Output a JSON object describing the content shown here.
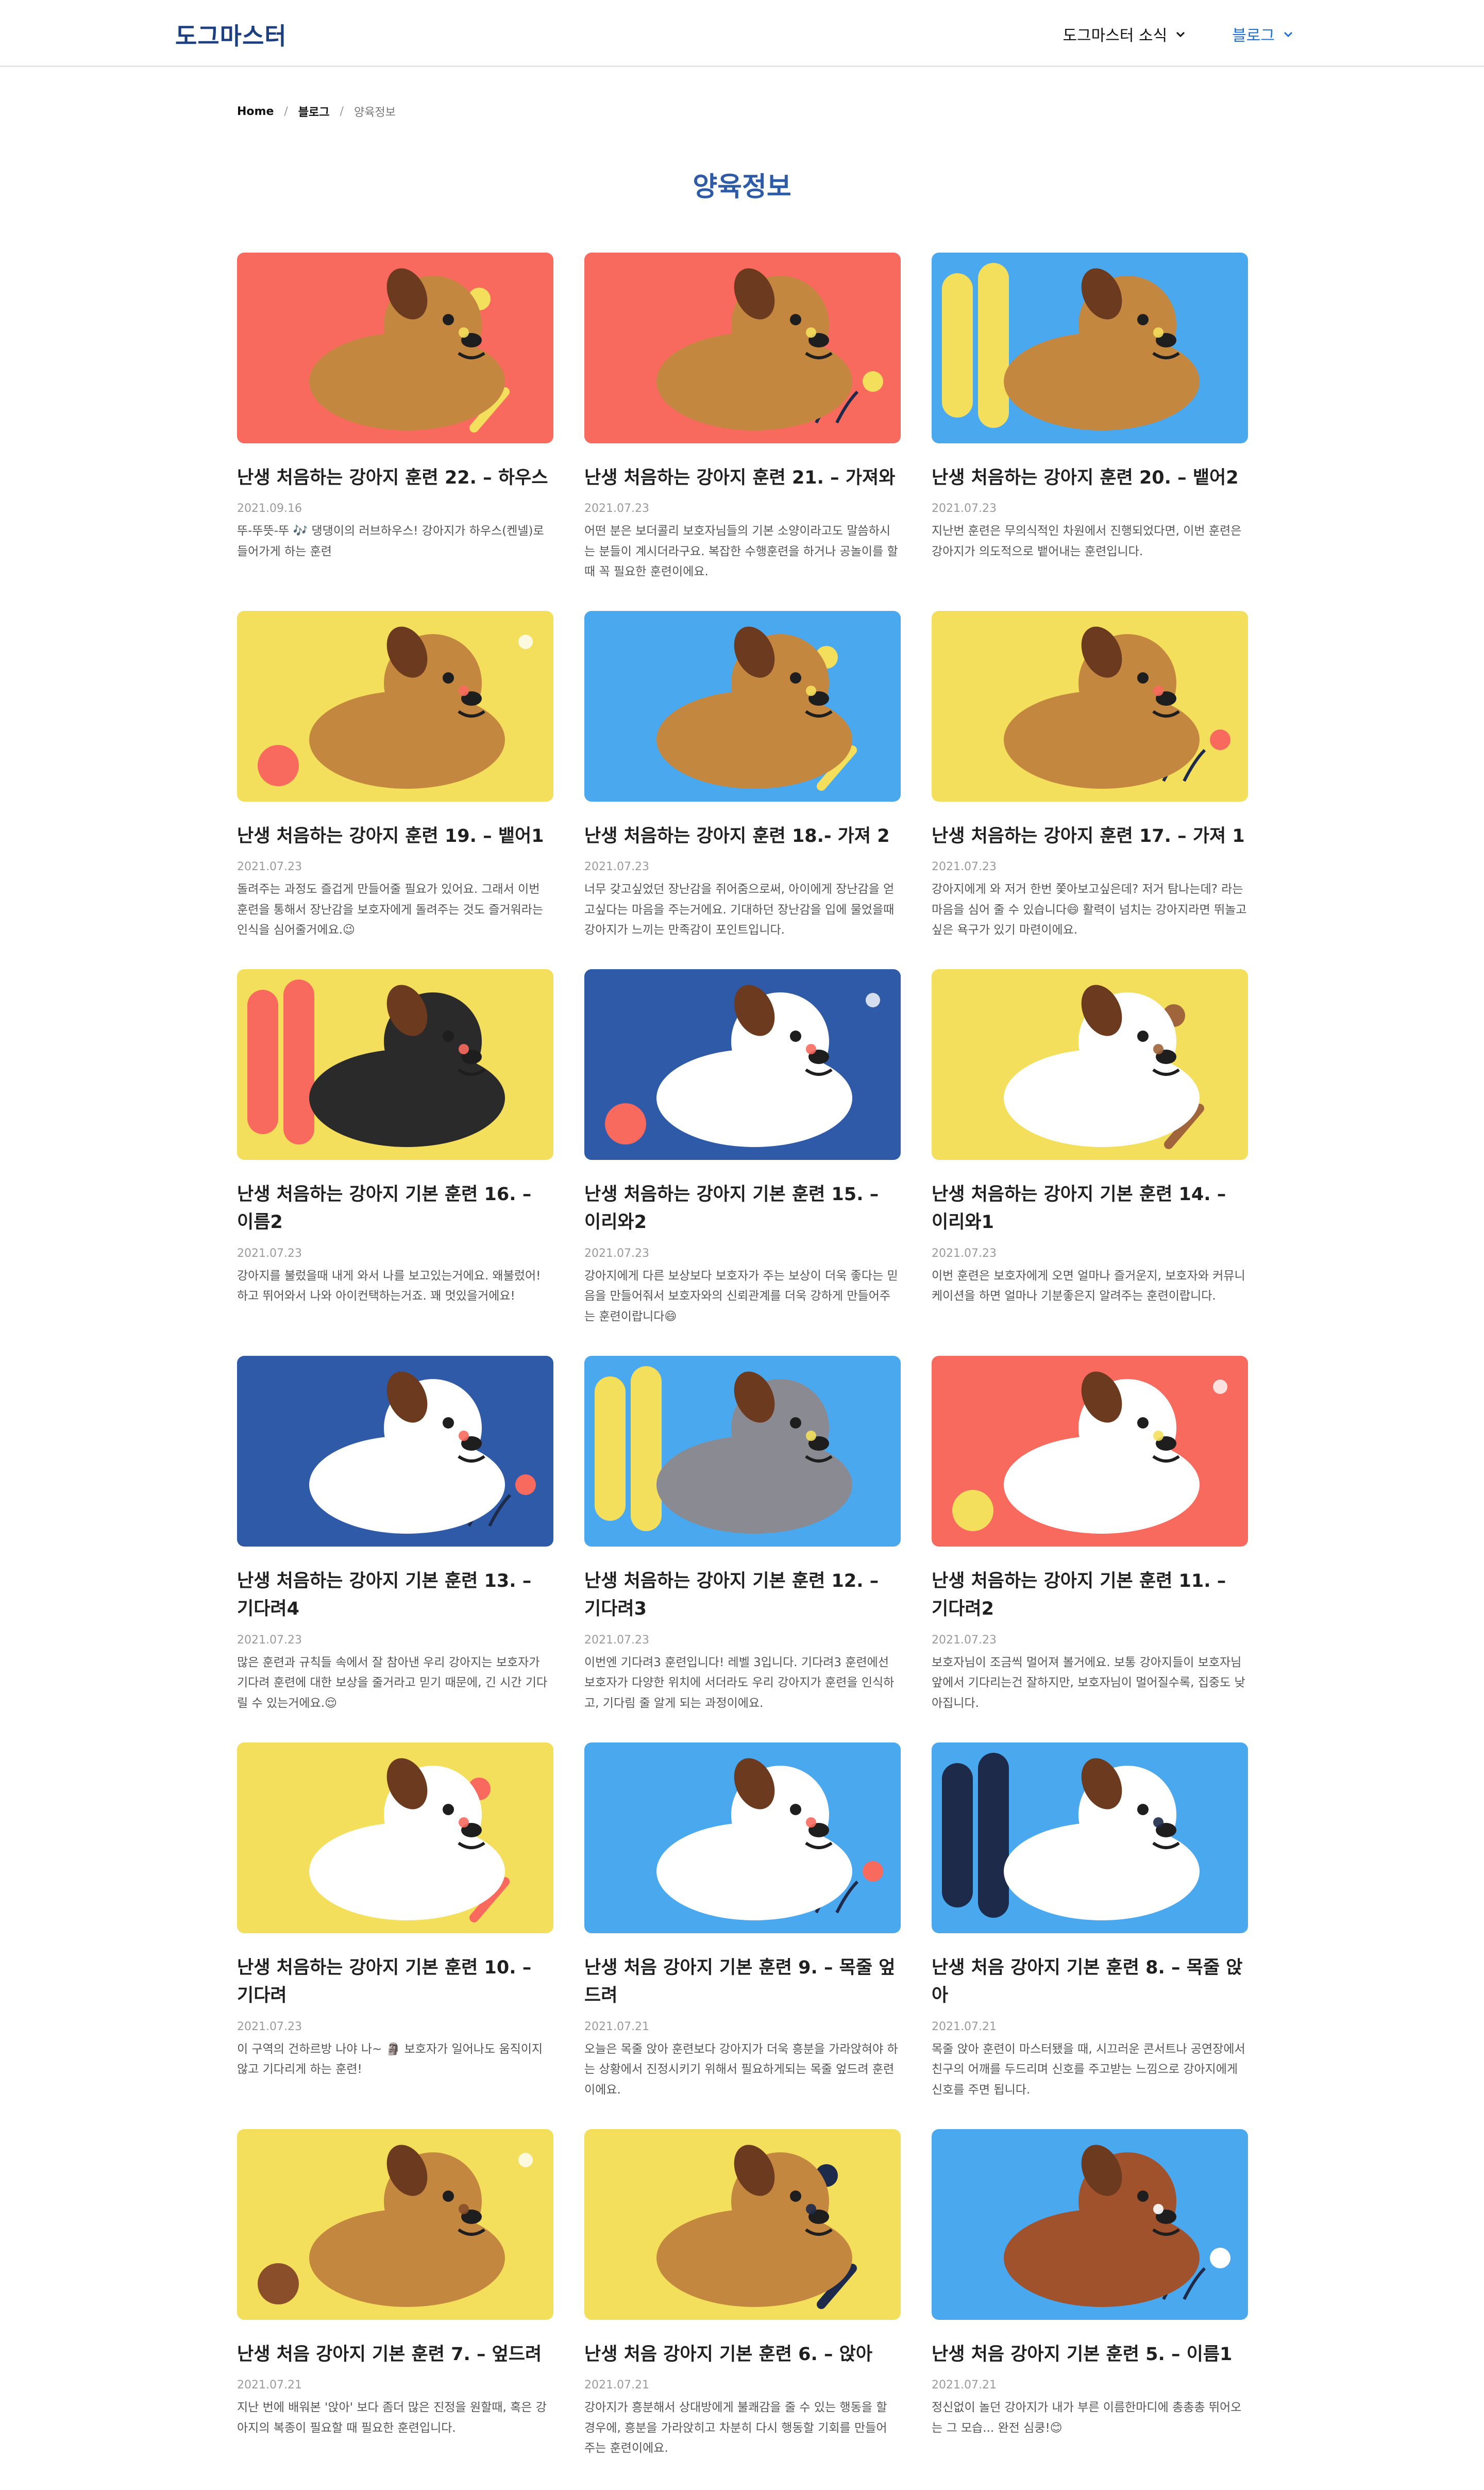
{
  "header": {
    "logo": "도그마스터",
    "nav": [
      {
        "label": "도그마스터 소식"
      },
      {
        "label": "블로그"
      }
    ]
  },
  "breadcrumb": {
    "home": "Home",
    "blog": "블로그",
    "current": "양육정보"
  },
  "page_title": "양육정보",
  "posts": [
    {
      "title": "난생 처음하는 강아지 훈련 22. – 하우스",
      "date": "2021.09.16",
      "desc": "뚜-뚜뜻-뚜 🎶 댕댕이의 러브하우스! 강아지가 하우스(켄넬)로 들어가게 하는 훈련",
      "bg": "#f96a5e",
      "dog": "#c4873f",
      "accent": "#f4df5c"
    },
    {
      "title": "난생 처음하는 강아지 훈련 21. – 가져와",
      "date": "2021.07.23",
      "desc": "어떤 분은 보더콜리 보호자님들의 기본 소양이라고도 말씀하시는 분들이 계시더라구요. 복잡한 수행훈련을 하거나 공놀이를 할 때 꼭 필요한 훈련이에요.",
      "bg": "#f96a5e",
      "dog": "#c4873f",
      "accent": "#f4df5c"
    },
    {
      "title": "난생 처음하는 강아지 훈련 20. – 뱉어2",
      "date": "2021.07.23",
      "desc": "지난번 훈련은 무의식적인 차원에서 진행되었다면, 이번 훈련은 강아지가 의도적으로 뱉어내는 훈련입니다.",
      "bg": "#4aa8ee",
      "dog": "#c4873f",
      "accent": "#f4df5c"
    },
    {
      "title": "난생 처음하는 강아지 훈련 19. – 뱉어1",
      "date": "2021.07.23",
      "desc": "돌려주는 과정도 즐겁게 만들어줄 필요가 있어요. 그래서 이번 훈련을 통해서 장난감을 보호자에게 돌려주는 것도 즐거워라는 인식을 심어줄거에요.😉",
      "bg": "#f4df5c",
      "dog": "#c4873f",
      "accent": "#f96a5e"
    },
    {
      "title": "난생 처음하는 강아지 훈련 18.- 가져 2",
      "date": "2021.07.23",
      "desc": "너무 갖고싶었던 장난감을 쥐어줌으로써, 아이에게 장난감을 얻고싶다는 마음을 주는거에요. 기대하던 장난감을 입에 물었을때 강아지가 느끼는 만족감이 포인트입니다.",
      "bg": "#4aa8ee",
      "dog": "#c4873f",
      "accent": "#f4df5c"
    },
    {
      "title": "난생 처음하는 강아지 훈련 17. – 가져 1",
      "date": "2021.07.23",
      "desc": "강아지에게 와 저거 한번 쫓아보고싶은데? 저거 탐나는데? 라는 마음을 심어 줄 수 있습니다😄 활력이 넘치는 강아지라면 뛰놀고 싶은 욕구가 있기 마련이에요.",
      "bg": "#f4df5c",
      "dog": "#c4873f",
      "accent": "#f96a5e"
    },
    {
      "title": "난생 처음하는 강아지 기본 훈련 16. – 이름2",
      "date": "2021.07.23",
      "desc": "강아지를 불렀을때 내게 와서 나를 보고있는거에요. 왜불렀어! 하고 뛰어와서 나와 아이컨택하는거죠. 꽤 멋있을거에요!",
      "bg": "#f4df5c",
      "dog": "#2a2a2a",
      "accent": "#f96a5e"
    },
    {
      "title": "난생 처음하는 강아지 기본 훈련 15. – 이리와2",
      "date": "2021.07.23",
      "desc": "강아지에게 다른 보상보다 보호자가 주는 보상이 더욱 좋다는 믿음을 만들어줘서 보호자와의 신뢰관계를 더욱 강하게 만들어주는 훈련이랍니다😄",
      "bg": "#2e5aa8",
      "dog": "#ffffff",
      "accent": "#f96a5e"
    },
    {
      "title": "난생 처음하는 강아지 기본 훈련 14. – 이리와1",
      "date": "2021.07.23",
      "desc": "이번 훈련은 보호자에게 오면 얼마나 즐거운지, 보호자와 커뮤니케이션을 하면 얼마나 기분좋은지 알려주는 훈련이랍니다.",
      "bg": "#f4df5c",
      "dog": "#ffffff",
      "accent": "#a0653a"
    },
    {
      "title": "난생 처음하는 강아지 기본 훈련 13. – 기다려4",
      "date": "2021.07.23",
      "desc": "많은 훈련과 규칙들 속에서 잘 참아낸 우리 강아지는 보호자가 기다려 훈련에 대한 보상을 줄거라고 믿기 때문에, 긴 시간 기다릴 수 있는거에요.😌",
      "bg": "#2e5aa8",
      "dog": "#ffffff",
      "accent": "#f96a5e"
    },
    {
      "title": "난생 처음하는 강아지 기본 훈련 12. – 기다려3",
      "date": "2021.07.23",
      "desc": "이번엔 기다려3 훈련입니다! 레벨 3입니다. 기다려3 훈련에선 보호자가 다양한 위치에 서더라도 우리 강아지가 훈련을 인식하고, 기다림 줄 알게 되는 과정이에요.",
      "bg": "#4aa8ee",
      "dog": "#8a8a92",
      "accent": "#f4df5c"
    },
    {
      "title": "난생 처음하는 강아지 기본 훈련 11. – 기다려2",
      "date": "2021.07.23",
      "desc": "보호자님이 조금씩 멀어져 볼거에요. 보통 강아지들이 보호자님 앞에서 기다리는건 잘하지만, 보호자님이 멀어질수록, 집중도 낮아집니다.",
      "bg": "#f96a5e",
      "dog": "#ffffff",
      "accent": "#f4df5c"
    },
    {
      "title": "난생 처음하는 강아지 기본 훈련 10. – 기다려",
      "date": "2021.07.23",
      "desc": "이 구역의 건하르방 나야 나~ 🗿 보호자가 일어나도 움직이지 않고 기다리게 하는 훈련!",
      "bg": "#f4df5c",
      "dog": "#ffffff",
      "accent": "#f96a5e"
    },
    {
      "title": "난생 처음 강아지 기본 훈련 9. – 목줄 엎드려",
      "date": "2021.07.21",
      "desc": "오늘은 목줄 앉아 훈련보다 강아지가 더욱 흥분을 가라앉혀야 하는 상황에서 진정시키기 위해서 필요하게되는 목줄 엎드려 훈련이에요.",
      "bg": "#4aa8ee",
      "dog": "#ffffff",
      "accent": "#f96a5e"
    },
    {
      "title": "난생 처음 강아지 기본 훈련 8. – 목줄 앉아",
      "date": "2021.07.21",
      "desc": "목줄 앉아 훈련이 마스터됐을 때, 시끄러운 콘서트나 공연장에서 친구의 어깨를 두드리며 신호를 주고받는 느낌으로 강아지에게 신호를 주면 됩니다.",
      "bg": "#4aa8ee",
      "dog": "#ffffff",
      "accent": "#1e2a4a"
    },
    {
      "title": "난생 처음 강아지 기본 훈련 7. – 엎드려",
      "date": "2021.07.21",
      "desc": "지난 번에 배워본 '앉아' 보다 좀더 많은 진정을 원할때, 혹은 강아지의 복종이 필요할 때 필요한 훈련입니다.",
      "bg": "#f4df5c",
      "dog": "#c4873f",
      "accent": "#8a4f2a"
    },
    {
      "title": "난생 처음 강아지 기본 훈련 6. – 앉아",
      "date": "2021.07.21",
      "desc": "강아지가 흥분해서 상대방에게 불쾌감을 줄 수 있는 행동을 할 경우에, 흥분을 가라앉히고 차분히 다시 행동할 기회를 만들어 주는 훈련이에요.",
      "bg": "#f4df5c",
      "dog": "#c4873f",
      "accent": "#1e2a4a"
    },
    {
      "title": "난생 처음 강아지 기본 훈련 5. – 이름1",
      "date": "2021.07.21",
      "desc": "정신없이 놀던 강아지가 내가 부른 이름한마디에 총총총 뛰어오는 그 모습... 완전 심쿵!😊",
      "bg": "#4aa8ee",
      "dog": "#a0522d",
      "accent": "#ffffff"
    }
  ]
}
